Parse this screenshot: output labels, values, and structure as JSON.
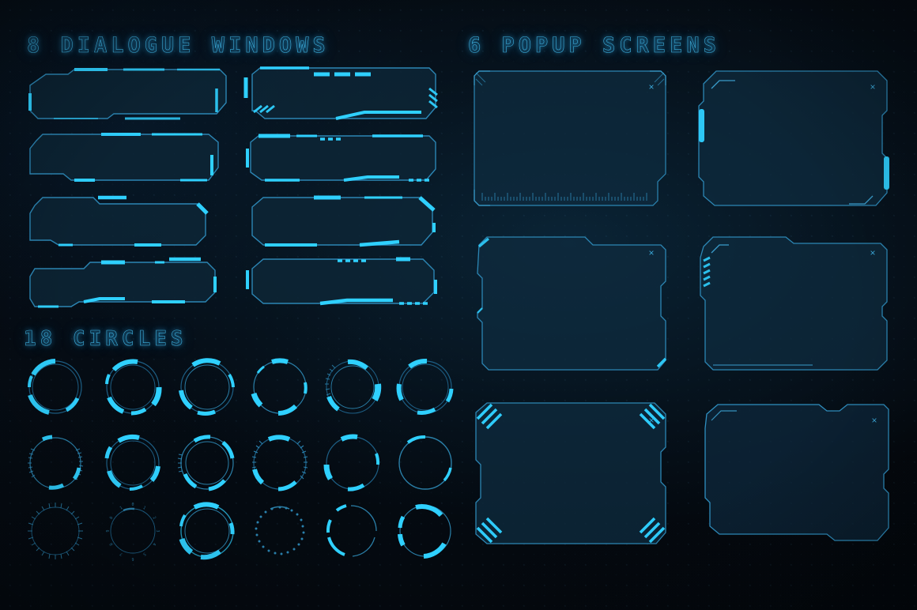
{
  "page": {
    "background_color": "#04080d",
    "accent_bright": "#29c3f5",
    "accent_line": "#2a7fa8",
    "accent_dim": "#1d5f85",
    "fill_color": "#0c2233"
  },
  "sections": [
    {
      "id": "dialogue",
      "title": "8 DIALOGUE WINDOWS",
      "count": 8,
      "item_type": "dialogue-window"
    },
    {
      "id": "popup",
      "title": "6 POPUP SCREENS",
      "count": 6,
      "item_type": "popup-screen"
    },
    {
      "id": "circles",
      "title": "18 CIRCLES",
      "count": 18,
      "item_type": "circle-gauge"
    }
  ],
  "dialogue_windows": [
    {
      "index": 1,
      "label": "dialogue-window-1",
      "style": "rounded-notched-bar"
    },
    {
      "index": 2,
      "label": "dialogue-window-2",
      "style": "dashed-top-hatch-right"
    },
    {
      "index": 3,
      "label": "dialogue-window-3",
      "style": "stepped-left-profile"
    },
    {
      "index": 4,
      "label": "dialogue-window-4",
      "style": "bright-top-left-hatch"
    },
    {
      "index": 5,
      "label": "dialogue-window-5",
      "style": "angled-right-corner"
    },
    {
      "index": 6,
      "label": "dialogue-window-6",
      "style": "double-angled-ends"
    },
    {
      "index": 7,
      "label": "dialogue-window-7",
      "style": "wide-bevel-left"
    },
    {
      "index": 8,
      "label": "dialogue-window-8",
      "style": "dash-marks-top-bottom"
    }
  ],
  "popup_screens": [
    {
      "index": 1,
      "label": "popup-screen-1",
      "close_label": "×",
      "style": "corner-brackets-with-ruler",
      "has_ruler": true
    },
    {
      "index": 2,
      "label": "popup-screen-2",
      "close_label": "×",
      "style": "clipped-corners-side-tabs",
      "has_ruler": false
    },
    {
      "index": 3,
      "label": "popup-screen-3",
      "close_label": "×",
      "style": "notched-top-angled-corners",
      "has_ruler": false
    },
    {
      "index": 4,
      "label": "popup-screen-4",
      "close_label": "×",
      "style": "hatched-left-edge",
      "has_ruler": false
    },
    {
      "index": 5,
      "label": "popup-screen-5",
      "close_label": "×",
      "style": "diagonal-stripe-corners",
      "has_ruler": false
    },
    {
      "index": 6,
      "label": "popup-screen-6",
      "close_label": "×",
      "style": "thin-outline-notched",
      "has_ruler": false
    }
  ],
  "circles": [
    {
      "index": 1,
      "label": "circle-gauge-1",
      "style": "thick-arcs"
    },
    {
      "index": 2,
      "label": "circle-gauge-2",
      "style": "thick-arcs-double-ring"
    },
    {
      "index": 3,
      "label": "circle-gauge-3",
      "style": "split-arcs"
    },
    {
      "index": 4,
      "label": "circle-gauge-4",
      "style": "segment-blocks"
    },
    {
      "index": 5,
      "label": "circle-gauge-5",
      "style": "tick-ring-arcs"
    },
    {
      "index": 6,
      "label": "circle-gauge-6",
      "style": "offset-arcs"
    },
    {
      "index": 7,
      "label": "circle-gauge-7",
      "style": "tick-dial-thin"
    },
    {
      "index": 8,
      "label": "circle-gauge-8",
      "style": "broken-double-ring"
    },
    {
      "index": 9,
      "label": "circle-gauge-9",
      "style": "bracket-arcs"
    },
    {
      "index": 10,
      "label": "circle-gauge-10",
      "style": "dense-tick-ring"
    },
    {
      "index": 11,
      "label": "circle-gauge-11",
      "style": "two-arc-gauge"
    },
    {
      "index": 12,
      "label": "circle-gauge-12",
      "style": "plain-ring"
    },
    {
      "index": 13,
      "label": "circle-gauge-13",
      "style": "fine-tick-dial"
    },
    {
      "index": 14,
      "label": "circle-gauge-14",
      "style": "labeled-tick-dial"
    },
    {
      "index": 15,
      "label": "circle-gauge-15",
      "style": "bright-layered-arcs"
    },
    {
      "index": 16,
      "label": "circle-gauge-16",
      "style": "dotted-ring"
    },
    {
      "index": 17,
      "label": "circle-gauge-17",
      "style": "thin-split-ring"
    },
    {
      "index": 18,
      "label": "circle-gauge-18",
      "style": "bold-arc-ring"
    }
  ]
}
